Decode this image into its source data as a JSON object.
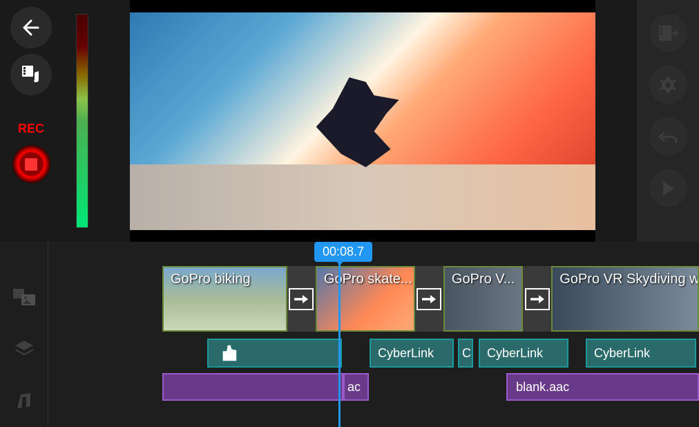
{
  "rec_label": "REC",
  "playhead_time": "00:08.7",
  "clips": [
    {
      "label": "GoPro biking"
    },
    {
      "label": "GoPro skate..."
    },
    {
      "label": "GoPro V..."
    },
    {
      "label": "GoPro VR  Skydiving wit"
    }
  ],
  "stickers": [
    {
      "label": ""
    },
    {
      "label": "CyberLink"
    },
    {
      "label": "C"
    },
    {
      "label": "CyberLink"
    },
    {
      "label": "CyberLink"
    }
  ],
  "audio_clips": [
    {
      "label": "ac"
    },
    {
      "label": "blank.aac"
    }
  ],
  "icons": {
    "back": "back-arrow-icon",
    "media": "media-music-icon"
  }
}
